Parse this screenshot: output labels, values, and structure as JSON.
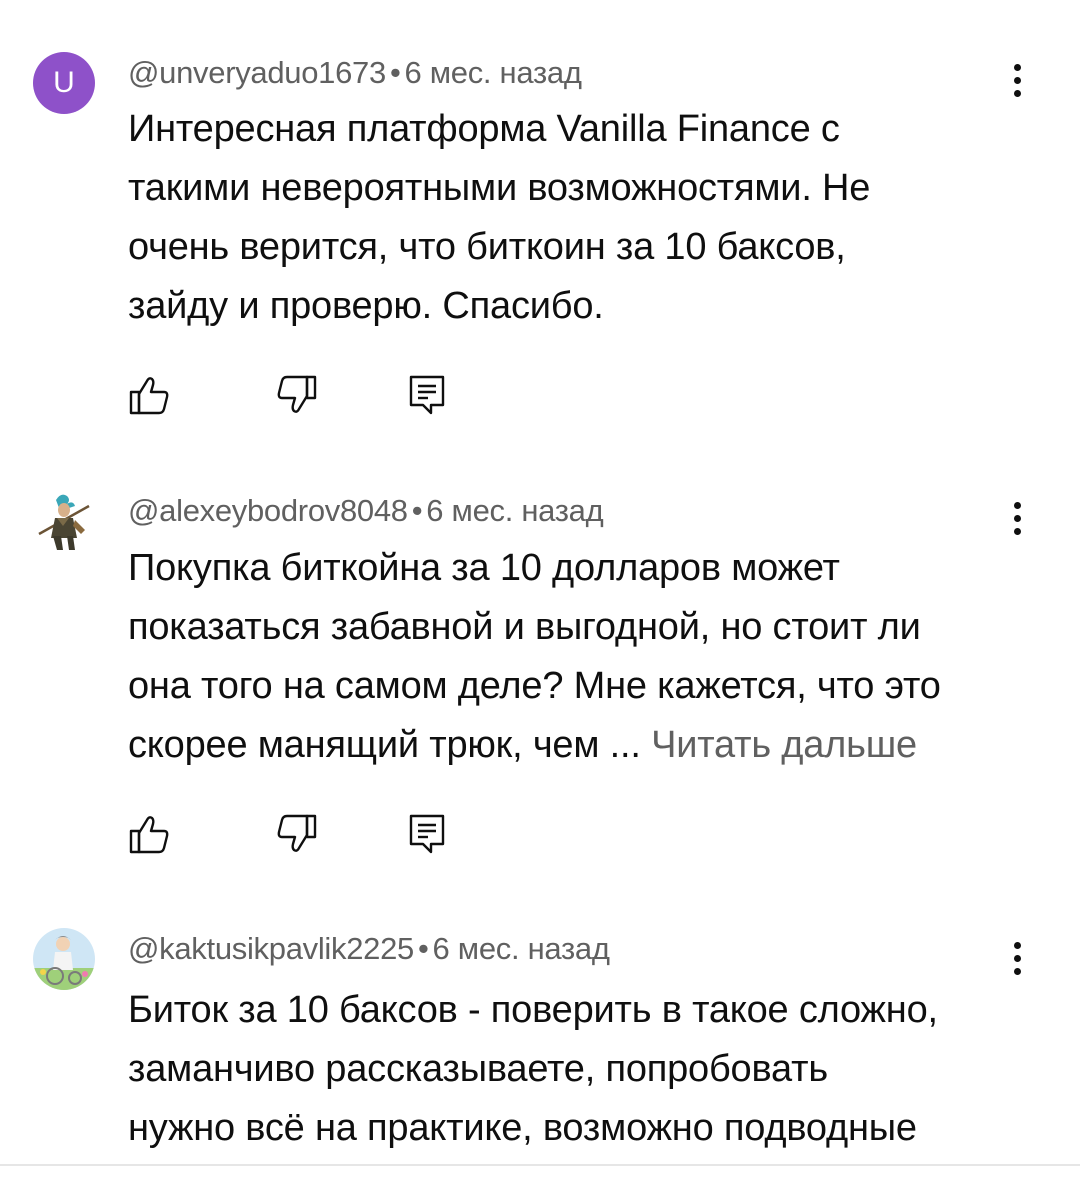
{
  "comments": [
    {
      "avatar_letter": "U",
      "avatar_color": "#8e51c9",
      "author": "@unveryaduo1673",
      "separator": "•",
      "time": "6 мес. назад",
      "lines": [
        "Интересная платформа Vanilla Finance с",
        "такими невероятными возможностями. Не",
        "очень верится, что биткоин за 10 баксов,",
        "зайду и проверю. Спасибо."
      ]
    },
    {
      "author": "@alexeybodrov8048",
      "separator": "•",
      "time": "6 мес. назад",
      "lines": [
        "Покупка биткойна за 10 долларов может",
        "показаться забавной и выгодной, но стоит ли",
        "она того на самом деле? Мне кажется, что это",
        "скорее манящий трюк, чем ..."
      ],
      "read_more": "Читать дальше"
    },
    {
      "author": "@kaktusikpavlik2225",
      "separator": "•",
      "time": "6 мес. назад",
      "lines": [
        "Биток за 10 баксов - поверить в такое сложно,",
        "заманчиво рассказываете, попробовать",
        "нужно всё на практике, возможно подводные"
      ]
    }
  ],
  "icons": {
    "like": "thumb-up-icon",
    "dislike": "thumb-down-icon",
    "reply": "reply-icon",
    "menu": "more-vert-icon"
  },
  "colors": {
    "text": "#0f0f0f",
    "secondary": "#606060",
    "avatar_u": "#8e51c9"
  }
}
